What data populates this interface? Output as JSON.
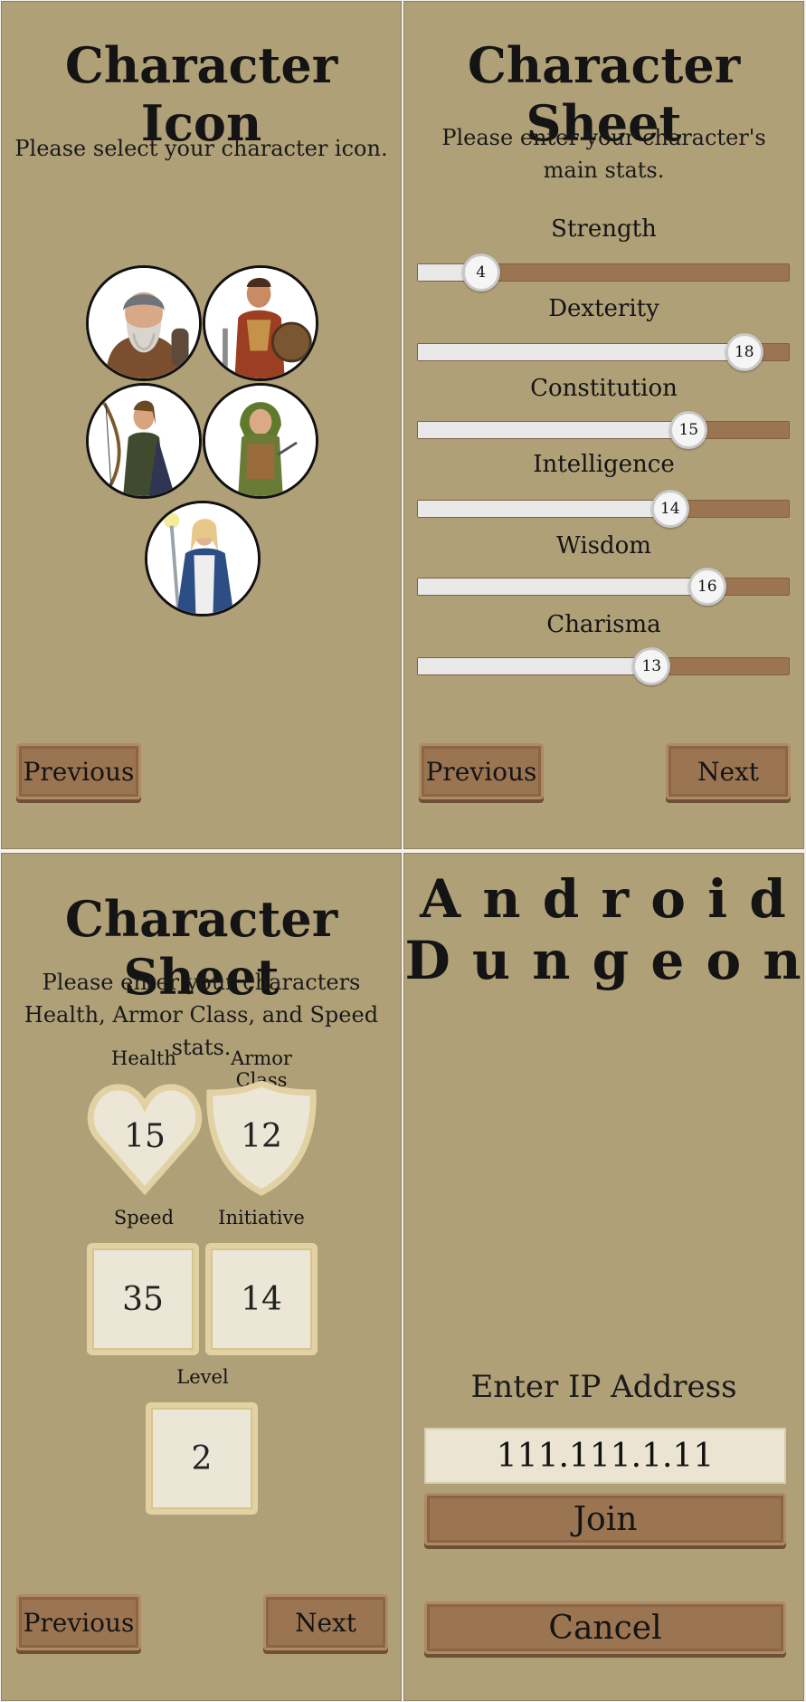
{
  "icon_screen": {
    "title": "Character Icon",
    "subtitle": "Please select your character icon.",
    "portraits": [
      {
        "name": "dwarf-warrior"
      },
      {
        "name": "human-fighter"
      },
      {
        "name": "elf-archer"
      },
      {
        "name": "hooded-rogue"
      },
      {
        "name": "robed-wizard"
      }
    ],
    "previous_label": "Previous"
  },
  "stats_screen": {
    "title": "Character Sheet",
    "subtitle": "Please enter your character's main stats.",
    "stats": [
      {
        "label": "Strength",
        "value": "4",
        "fill": 0.17
      },
      {
        "label": "Dexterity",
        "value": "18",
        "fill": 0.88
      },
      {
        "label": "Constitution",
        "value": "15",
        "fill": 0.73
      },
      {
        "label": "Intelligence",
        "value": "14",
        "fill": 0.68
      },
      {
        "label": "Wisdom",
        "value": "16",
        "fill": 0.78
      },
      {
        "label": "Charisma",
        "value": "13",
        "fill": 0.63
      }
    ],
    "previous_label": "Previous",
    "next_label": "Next"
  },
  "combat_screen": {
    "title": "Character Sheet",
    "subtitle": "Please enter your characters Health, Armor Class, and Speed stats.",
    "health": {
      "label": "Health",
      "value": "15"
    },
    "armor_class": {
      "label": "Armor Class",
      "value": "12"
    },
    "speed": {
      "label": "Speed",
      "value": "35"
    },
    "initiative": {
      "label": "Initiative",
      "value": "14"
    },
    "level": {
      "label": "Level",
      "value": "2"
    },
    "previous_label": "Previous",
    "next_label": "Next"
  },
  "join_screen": {
    "title_line1": "A n d r o i d",
    "title_line2": "D u n g e o n",
    "ip_label": "Enter IP Address",
    "ip_value": "111.111.1.11",
    "join_label": "Join",
    "cancel_label": "Cancel"
  },
  "colors": {
    "panel_bg": "#b0a078",
    "wood_button": "#9b7552",
    "slider_track": "#9b7552",
    "tile_bg": "#ece6d6"
  }
}
